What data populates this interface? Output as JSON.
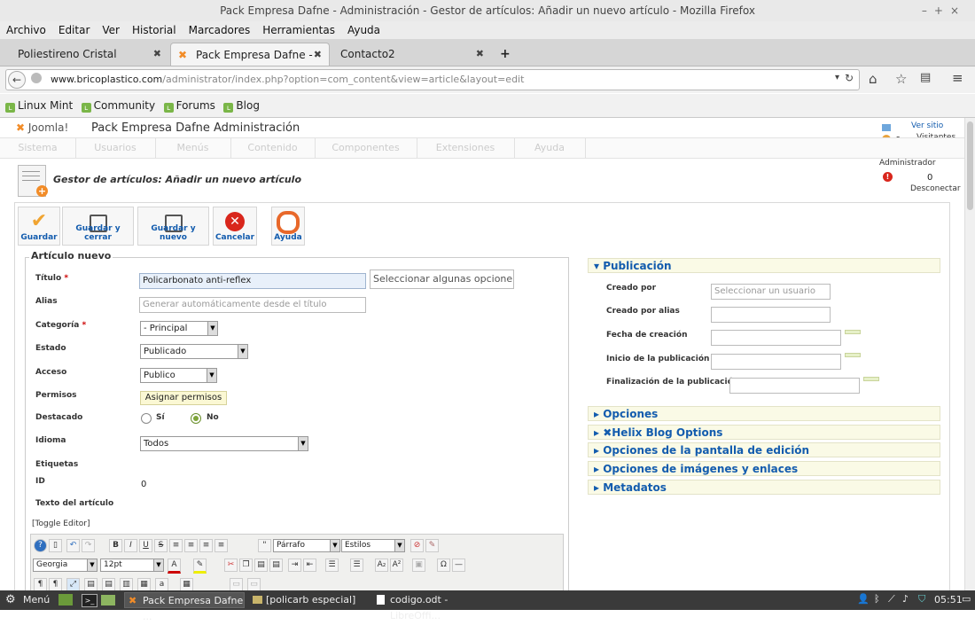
{
  "window": {
    "title": "Pack Empresa Dafne - Administración - Gestor de artículos: Añadir un nuevo artículo - Mozilla Firefox"
  },
  "menu": [
    "Archivo",
    "Editar",
    "Ver",
    "Historial",
    "Marcadores",
    "Herramientas",
    "Ayuda"
  ],
  "tabs": [
    {
      "label": "Poliestireno Cristal"
    },
    {
      "label": "Pack Empresa Dafne - Ad..."
    },
    {
      "label": "Contacto2"
    }
  ],
  "nav": {
    "url_domain": "www.bricoplastico.com",
    "url_path": "/administrator/index.php?option=com_content&view=article&layout=edit"
  },
  "bookmarks": [
    "Linux Mint",
    "Community",
    "Forums",
    "Blog"
  ],
  "joomla": {
    "brand": "Joomla!",
    "site_title": "Pack Empresa Dafne Administración",
    "nav": [
      "Sistema",
      "Usuarios",
      "Menús",
      "Contenido",
      "Componentes",
      "Extensiones",
      "Ayuda"
    ],
    "status": {
      "ver_sitio": "Ver sitio",
      "visitors_count": "0",
      "visitors_label": "Visitantes",
      "admins_count": "1",
      "admins_label": "Administrador",
      "messages_count": "0",
      "logout": "Desconectar"
    }
  },
  "page": {
    "title": "Gestor de artículos: Añadir un nuevo artículo",
    "toolbar": [
      "Guardar",
      "Guardar y cerrar",
      "Guardar y nuevo",
      "Cancelar",
      "Ayuda"
    ]
  },
  "form": {
    "legend": "Artículo nuevo",
    "title_label": "Título",
    "title_value": "Policarbonato anti-reflex",
    "tags_placeholder": "Seleccionar algunas opcione",
    "alias_label": "Alias",
    "alias_placeholder": "Generar automáticamente desde el título",
    "category_label": "Categoría",
    "category_value": "- Principal",
    "state_label": "Estado",
    "state_value": "Publicado",
    "access_label": "Acceso",
    "access_value": "Publico",
    "perms_label": "Permisos",
    "perms_button": "Asignar permisos",
    "featured_label": "Destacado",
    "featured_yes": "Sí",
    "featured_no": "No",
    "language_label": "Idioma",
    "language_value": "Todos",
    "tags_label": "Etiquetas",
    "id_label": "ID",
    "id_value": "0",
    "text_label": "Texto del artículo",
    "toggle_editor": "[Toggle Editor]"
  },
  "editor": {
    "format": "Párrafo",
    "styles": "Estilos",
    "font": "Georgia",
    "size": "12pt"
  },
  "publish": {
    "heading": "Publicación",
    "created_by_label": "Creado por",
    "created_by_placeholder": "Seleccionar un usuario",
    "created_alias_label": "Creado por alias",
    "created_date_label": "Fecha de creación",
    "publish_up_label": "Inicio de la publicación",
    "publish_down_label": "Finalización de la publicación"
  },
  "sections": [
    "Opciones",
    "Helix Blog Options",
    "Opciones de la pantalla de edición",
    "Opciones de imágenes y enlaces",
    "Metadatos"
  ],
  "taskbar": {
    "menu": "Menú",
    "tasks": [
      "Pack Empresa Dafne ...",
      "[policarb especial]",
      "codigo.odt - LibreOffi..."
    ],
    "clock": "05:51"
  }
}
